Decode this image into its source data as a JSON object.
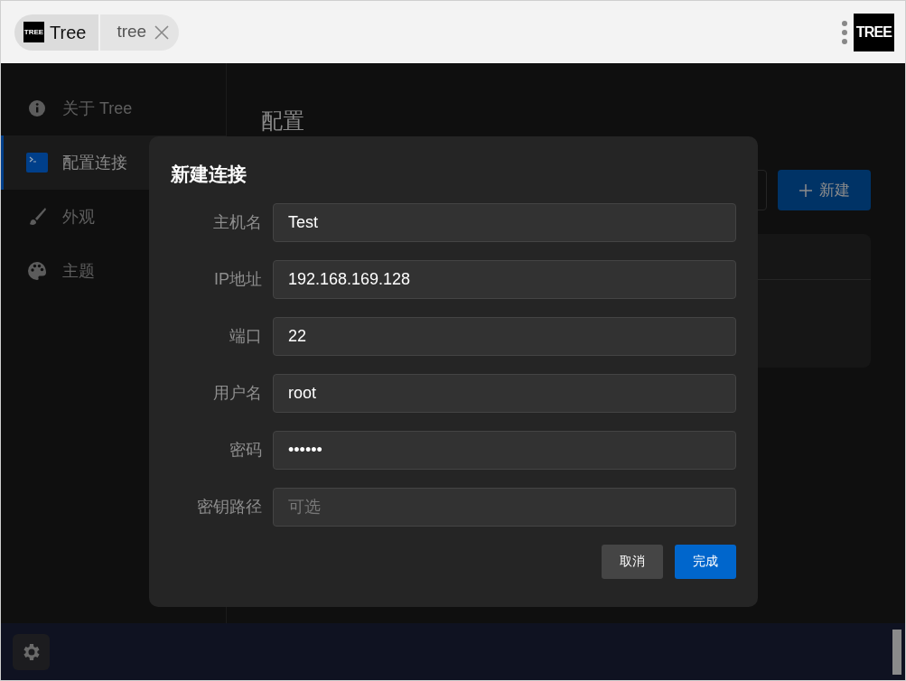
{
  "header": {
    "logo": "TREE",
    "breadcrumbs": [
      {
        "label": "Tree",
        "kind": "root"
      },
      {
        "label": "tree",
        "kind": "tab"
      }
    ],
    "app_logo": "TREE"
  },
  "sidebar": {
    "items": [
      {
        "label": "关于 Tree",
        "selected": false
      },
      {
        "label": "配置连接",
        "selected": true
      },
      {
        "label": "外观",
        "selected": false
      },
      {
        "label": "主题",
        "selected": false
      }
    ]
  },
  "page": {
    "title": "配置",
    "new_button": "新建"
  },
  "dialog": {
    "title": "新建连接",
    "fields": [
      {
        "label": "主机名",
        "value": "Test"
      },
      {
        "label": "IP地址",
        "value": "192.168.169.128"
      },
      {
        "label": "端口",
        "value": "22"
      },
      {
        "label": "用户名",
        "value": "root"
      },
      {
        "label": "密码",
        "value": "••••••"
      },
      {
        "label": "密钥路径",
        "placeholder": "可选"
      }
    ],
    "buttons": [
      {
        "label": "取消",
        "kind": "secondary"
      },
      {
        "label": "完成",
        "kind": "primary"
      }
    ]
  }
}
